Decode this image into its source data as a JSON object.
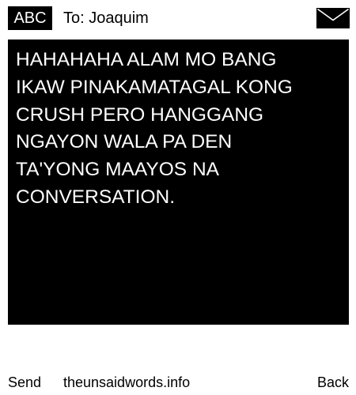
{
  "header": {
    "input_mode": "ABC",
    "recipient": "To: Joaquim",
    "envelope_icon": "envelope-icon"
  },
  "message": {
    "body": "HAHAHAHA ALAM MO BANG\nIKAW PINAKAMATAGAL KONG\nCRUSH PERO HANGGANG\nNGAYON WALA PA DEN\nTA'YONG MAAYOS NA\nCONVERSATION."
  },
  "softkeys": {
    "left": "Send",
    "center": "theunsaidwords.info",
    "right": "Back"
  },
  "colors": {
    "background": "#ffffff",
    "message_background": "#000000",
    "message_text": "#ffffff"
  }
}
